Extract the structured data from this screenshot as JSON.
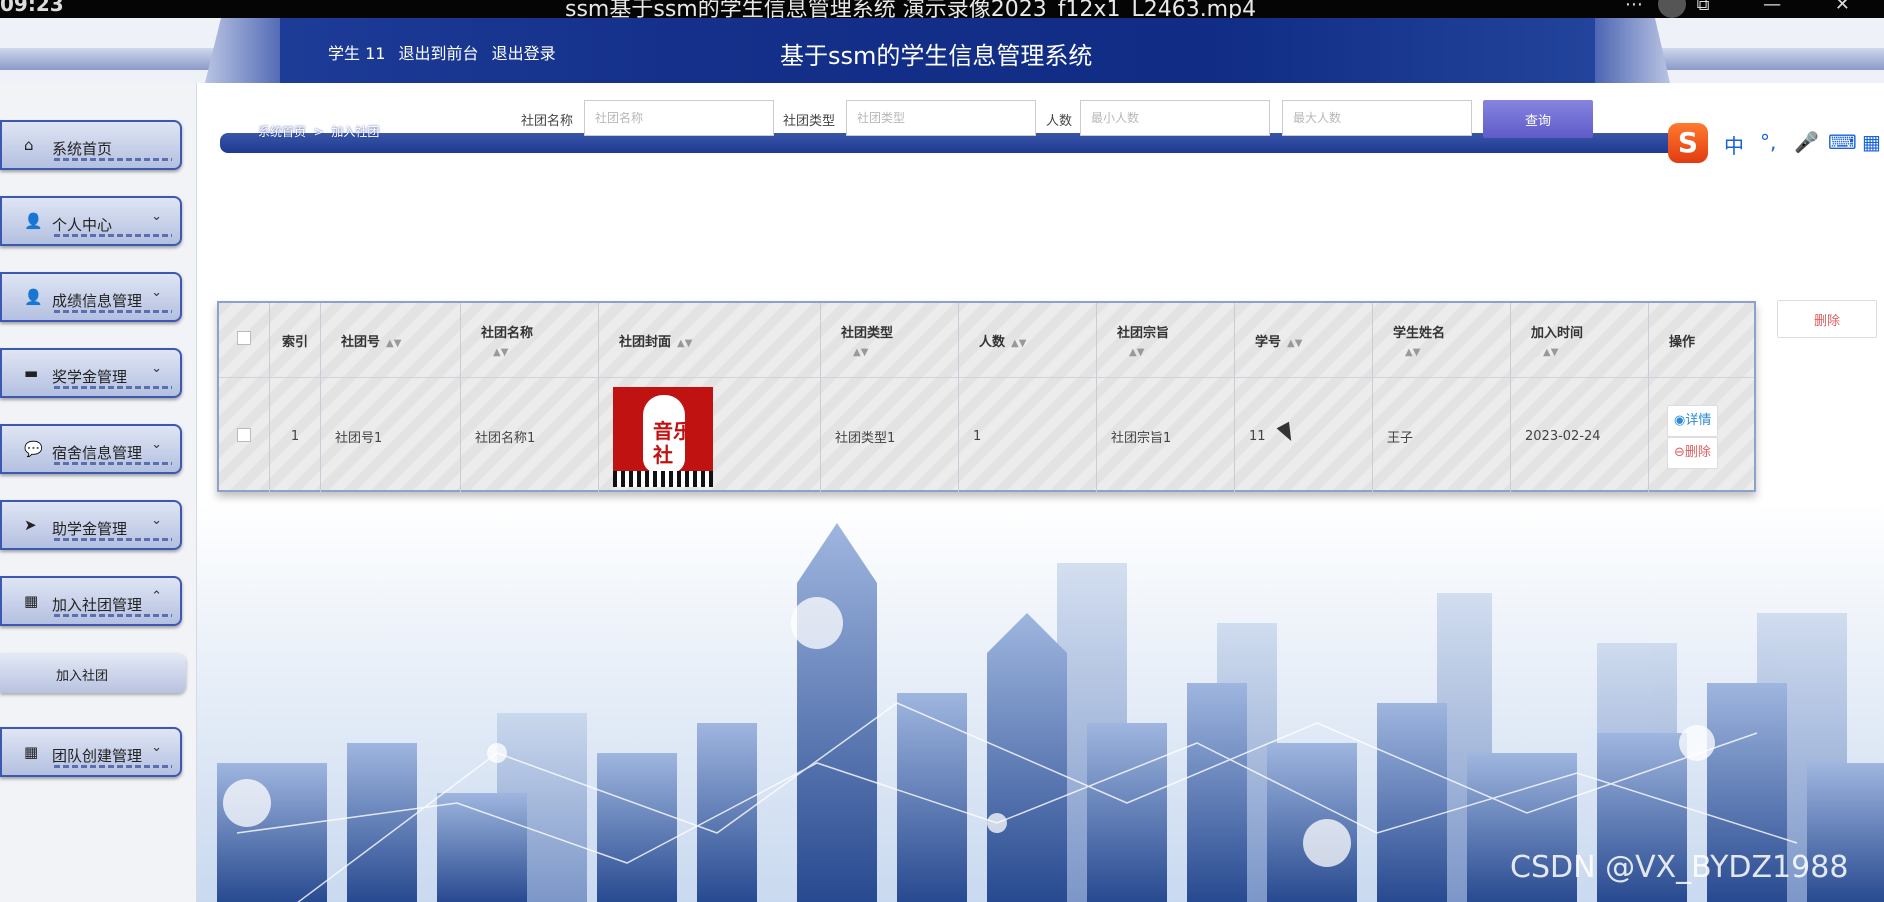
{
  "video": {
    "clock": "09:23",
    "title": "ssm基于ssm的学生信息管理系统 演示录像2023_f12x1_L2463.mp4",
    "controls": "⋯ ⧉ — ✕"
  },
  "header": {
    "user": "学生 11",
    "front_link": "退出到前台",
    "logout_link": "退出登录",
    "title": "基于ssm的学生信息管理系统"
  },
  "sidebar": {
    "items": [
      {
        "label": "系统首页",
        "icon": "home-icon",
        "glyph": "⌂",
        "chevron": ""
      },
      {
        "label": "个人中心",
        "icon": "user-icon",
        "glyph": "👤",
        "chevron": "⌄"
      },
      {
        "label": "成绩信息管理",
        "icon": "user-icon",
        "glyph": "👤",
        "chevron": "⌄"
      },
      {
        "label": "奖学金管理",
        "icon": "card-icon",
        "glyph": "▬",
        "chevron": "⌄"
      },
      {
        "label": "宿舍信息管理",
        "icon": "chat-icon",
        "glyph": "💬",
        "chevron": "⌄"
      },
      {
        "label": "助学金管理",
        "icon": "send-icon",
        "glyph": "➤",
        "chevron": "⌄"
      },
      {
        "label": "加入社团管理",
        "icon": "grid-icon",
        "glyph": "▦",
        "chevron": "⌃"
      },
      {
        "label": "团队创建管理",
        "icon": "grid-icon",
        "glyph": "▦",
        "chevron": "⌄"
      }
    ],
    "sub_item": "加入社团"
  },
  "breadcrumb": {
    "home": "系统首页",
    "sep": ">",
    "current": "加入社团"
  },
  "search": {
    "name_label": "社团名称",
    "name_placeholder": "社团名称",
    "type_label": "社团类型",
    "type_placeholder": "社团类型",
    "count_label": "人数",
    "min_placeholder": "最小人数",
    "max_placeholder": "最大人数",
    "button": "查询"
  },
  "toolbar": {
    "delete": "删除"
  },
  "table": {
    "headers": {
      "index": "索引",
      "club_no": "社团号",
      "club_name": "社团名称",
      "cover": "社团封面",
      "club_type": "社团类型",
      "count": "人数",
      "purpose": "社团宗旨",
      "student_no": "学号",
      "student_name": "学生姓名",
      "join_time": "加入时间",
      "ops": "操作"
    },
    "rows": [
      {
        "index": "1",
        "club_no": "社团号1",
        "club_name": "社团名称1",
        "cover_text_1": "音乐",
        "cover_text_2": "社",
        "club_type": "社团类型1",
        "count": "1",
        "purpose": "社团宗旨1",
        "student_no": "11",
        "student_name": "王子",
        "join_time": "2023-02-24",
        "detail": "详情",
        "delete": "删除"
      }
    ]
  },
  "ime": {
    "logo": "S",
    "items": [
      "中",
      "°,",
      "🎤",
      "⌨",
      "▦"
    ]
  },
  "watermark": "CSDN @VX_BYDZ1988",
  "colors": {
    "header": "#14308a",
    "search_button": "#6f6bd3",
    "delete": "#e35d5d",
    "detail": "#2a8ad8"
  }
}
